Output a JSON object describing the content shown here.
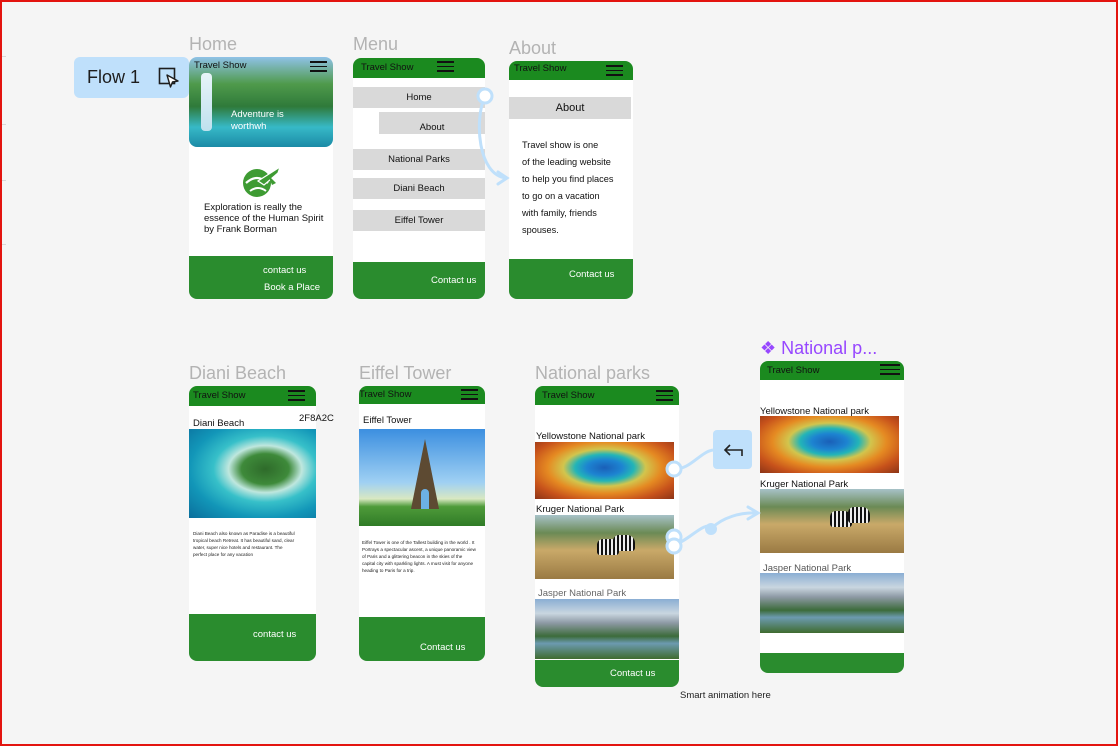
{
  "flow": {
    "label": "Flow 1"
  },
  "brand": "Travel Show",
  "frames": {
    "home": {
      "title": "Home",
      "hero_caption_1": "Adventure is",
      "hero_caption_2": "worthwh",
      "quote_1": "Exploration is really the",
      "quote_2": "essence of the Human Spirit",
      "quote_3": "by Frank Borman",
      "footer_link_1": "contact us",
      "footer_link_2": "Book a Place"
    },
    "menu": {
      "title": "Menu",
      "items": [
        "Home",
        "About",
        "National Parks",
        "Diani Beach",
        "Eiffel Tower"
      ],
      "footer_link": "Contact us"
    },
    "about": {
      "title": "About",
      "heading": "About",
      "body": [
        "Travel show is one",
        "of the leading website",
        "to help you find places",
        "to go on a vacation",
        "with family, friends",
        "spouses."
      ],
      "footer_link": "Contact us"
    },
    "diani": {
      "title": "Diani Beach",
      "heading": "Diani Beach",
      "code": "2F8A2C",
      "body": [
        "Diani Beach also known as Paradise is a beautiful",
        "tropical beach Retreat. It has beautiful sand, clear",
        "water, super nice hotels and restaurant.  The",
        "perfect place for any vacation"
      ],
      "footer_link": "contact us"
    },
    "eiffel": {
      "title": "Eiffel Tower",
      "heading": "Eiffel Tower",
      "body": [
        "Eiffel Tower is one of the Tallest building in the world . It",
        "Portrays a spectacular ascent, a unique panoramic view",
        "of Paris and a glittering beacon in the skies of the",
        "capital city with sparkling lights. A must visit for anyone",
        "heading to Paris for a trip."
      ],
      "footer_link": "Contact us"
    },
    "parks": {
      "title": "National parks",
      "parks": [
        "Yellowstone National park",
        "Kruger National Park",
        "Jasper National Park"
      ],
      "footer_link": "Contact us"
    },
    "parks_component": {
      "title": "❖ National p...",
      "parks": [
        "Yellowstone National park",
        "Kruger National Park",
        "Jasper National Park"
      ]
    }
  },
  "note": "Smart animation here",
  "colors": {
    "header_green": "#1b8a1f",
    "footer_green": "#2a8c2e",
    "connector_blue": "#bfe0fb",
    "component_purple": "#9747ff",
    "canvas_border": "#e3140f"
  }
}
